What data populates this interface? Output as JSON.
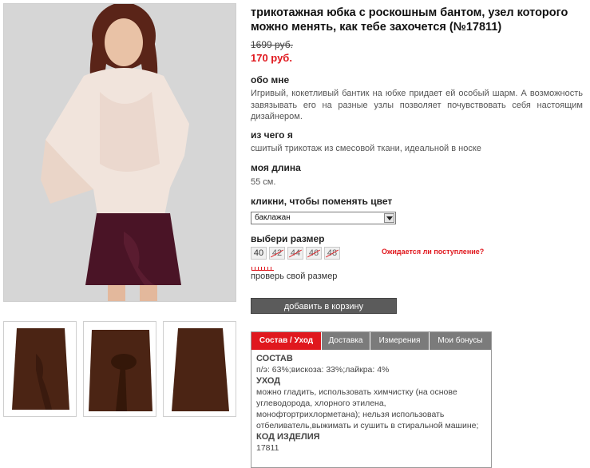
{
  "product": {
    "title": "трикотажная юбка с роскошным бантом, узел которого можно менять, как тебе захочется (№17811)",
    "old_price": "1699 руб.",
    "new_price": "170 руб."
  },
  "sections": {
    "about_heading": "обо мне",
    "about_text": "Игривый, кокетливый бантик на юбке придает ей особый шарм. А возможность завязывать его на разные узлы позволяет почувствовать себя настоящим дизайнером.",
    "material_heading": "из чего я",
    "material_text": "сшитый трикотаж из смесовой ткани, идеальной в носке",
    "length_heading": "моя длина",
    "length_text": "55 см.",
    "color_heading": "кликни, чтобы поменять цвет",
    "color_selected": "баклажан",
    "size_heading": "выбери размер",
    "sizes": [
      "40",
      "42",
      "44",
      "46",
      "48"
    ],
    "waiting_link": "Ожидается ли поступление?",
    "check_size": "проверь свой размер",
    "cart_button": "добавить в корзину"
  },
  "tabs": [
    "Состав / Уход",
    "Доставка",
    "Измерения",
    "Мои бонусы"
  ],
  "tab_content": {
    "composition_heading": "СОСТАВ",
    "composition_text": "п/э: 63%;вискоза: 33%;лайкра: 4%",
    "care_heading": "УХОД",
    "care_text": "можно гладить, использовать химчистку (на основе углеводорода, хлорного этилена, монофтортрихлорметана); нельзя использовать отбеливатель,выжимать и сушить в стиральной машине;",
    "code_heading": "КОД ИЗДЕЛИЯ",
    "code_value": "17811"
  },
  "colors": {
    "accent": "#e0181e",
    "button": "#5b5b5b",
    "tab_inactive": "#7b7b7b"
  }
}
